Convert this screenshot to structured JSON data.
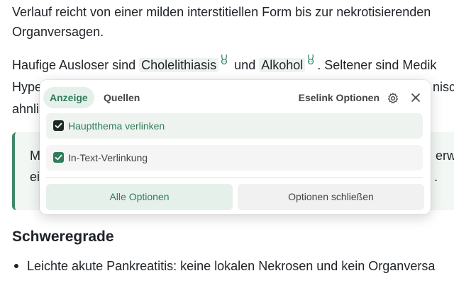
{
  "article": {
    "line1": "Verlauf reicht von einer milden interstitiellen Form bis zur nekrotisierenden",
    "line2": "Organversagen.",
    "line3_a": "Haufige Ausloser sind ",
    "line3_link1": "Cholelithiasis",
    "line3_b": " und ",
    "line3_link2": "Alkohol",
    "line3_c": ". Seltener sind Medik",
    "line4": "Hype",
    "line4_end": "nisc",
    "line5": "ahnli",
    "callout_line1_start": "M",
    "callout_line1_end": "erw",
    "callout_line2_start": "ei",
    "callout_line2_end": ".",
    "heading": "Schweregrade",
    "bullet": "Leichte akute Pankreatitis: keine lokalen Nekrosen und kein Organversa"
  },
  "popover": {
    "tabs": [
      {
        "label": "Anzeige",
        "active": true
      },
      {
        "label": "Quellen",
        "active": false
      }
    ],
    "options_title": "Eselink Optionen",
    "options": [
      {
        "label": "Hauptthema verlinken",
        "checked": true
      },
      {
        "label": "In-Text-Verlinkung",
        "checked": true
      }
    ],
    "all_options_button": "Alle Optionen",
    "close_options_button": "Optionen schließen"
  },
  "colors": {
    "accent": "#2e7d5b",
    "accent_bg": "#e6f0ea",
    "callout_border": "#3f8a69"
  },
  "icons": [
    "bunny-icon",
    "gear-icon",
    "close-icon",
    "checkmark-icon"
  ]
}
